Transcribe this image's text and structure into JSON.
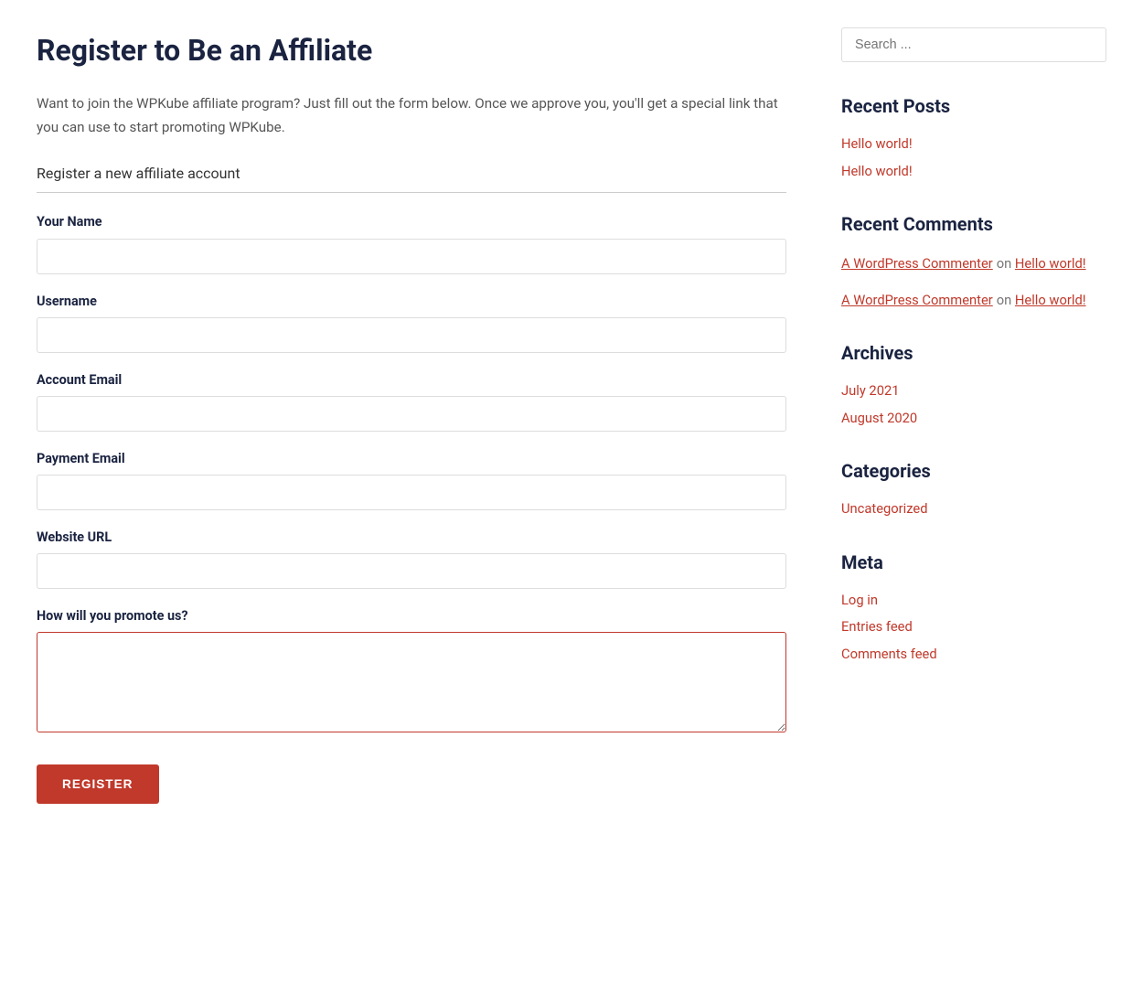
{
  "page": {
    "title": "Register to Be an Affiliate",
    "intro_text": "Want to join the WPKube affiliate program? Just fill out the form below. Once we approve you, you'll get a special link that you can use to start promoting WPKube.",
    "form_section_title": "Register a new affiliate account",
    "fields": [
      {
        "id": "your-name",
        "label": "Your Name",
        "type": "text",
        "placeholder": ""
      },
      {
        "id": "username",
        "label": "Username",
        "type": "text",
        "placeholder": ""
      },
      {
        "id": "account-email",
        "label": "Account Email",
        "type": "email",
        "placeholder": ""
      },
      {
        "id": "payment-email",
        "label": "Payment Email",
        "type": "email",
        "placeholder": ""
      },
      {
        "id": "website-url",
        "label": "Website URL",
        "type": "url",
        "placeholder": ""
      }
    ],
    "textarea_label": "How will you promote us?",
    "register_button": "REGISTER"
  },
  "sidebar": {
    "search_placeholder": "Search ...",
    "recent_posts_title": "Recent Posts",
    "recent_posts": [
      {
        "label": "Hello world!"
      },
      {
        "label": "Hello world!"
      }
    ],
    "recent_comments_title": "Recent Comments",
    "recent_comments": [
      {
        "commenter": "A WordPress Commenter",
        "on": "on",
        "post": "Hello world!"
      },
      {
        "commenter": "A WordPress Commenter",
        "on": "on",
        "post": "Hello world!"
      }
    ],
    "archives_title": "Archives",
    "archives": [
      {
        "label": "July 2021"
      },
      {
        "label": "August 2020"
      }
    ],
    "categories_title": "Categories",
    "categories": [
      {
        "label": "Uncategorized"
      }
    ],
    "meta_title": "Meta",
    "meta_links": [
      {
        "label": "Log in"
      },
      {
        "label": "Entries feed"
      },
      {
        "label": "Comments feed"
      }
    ]
  }
}
